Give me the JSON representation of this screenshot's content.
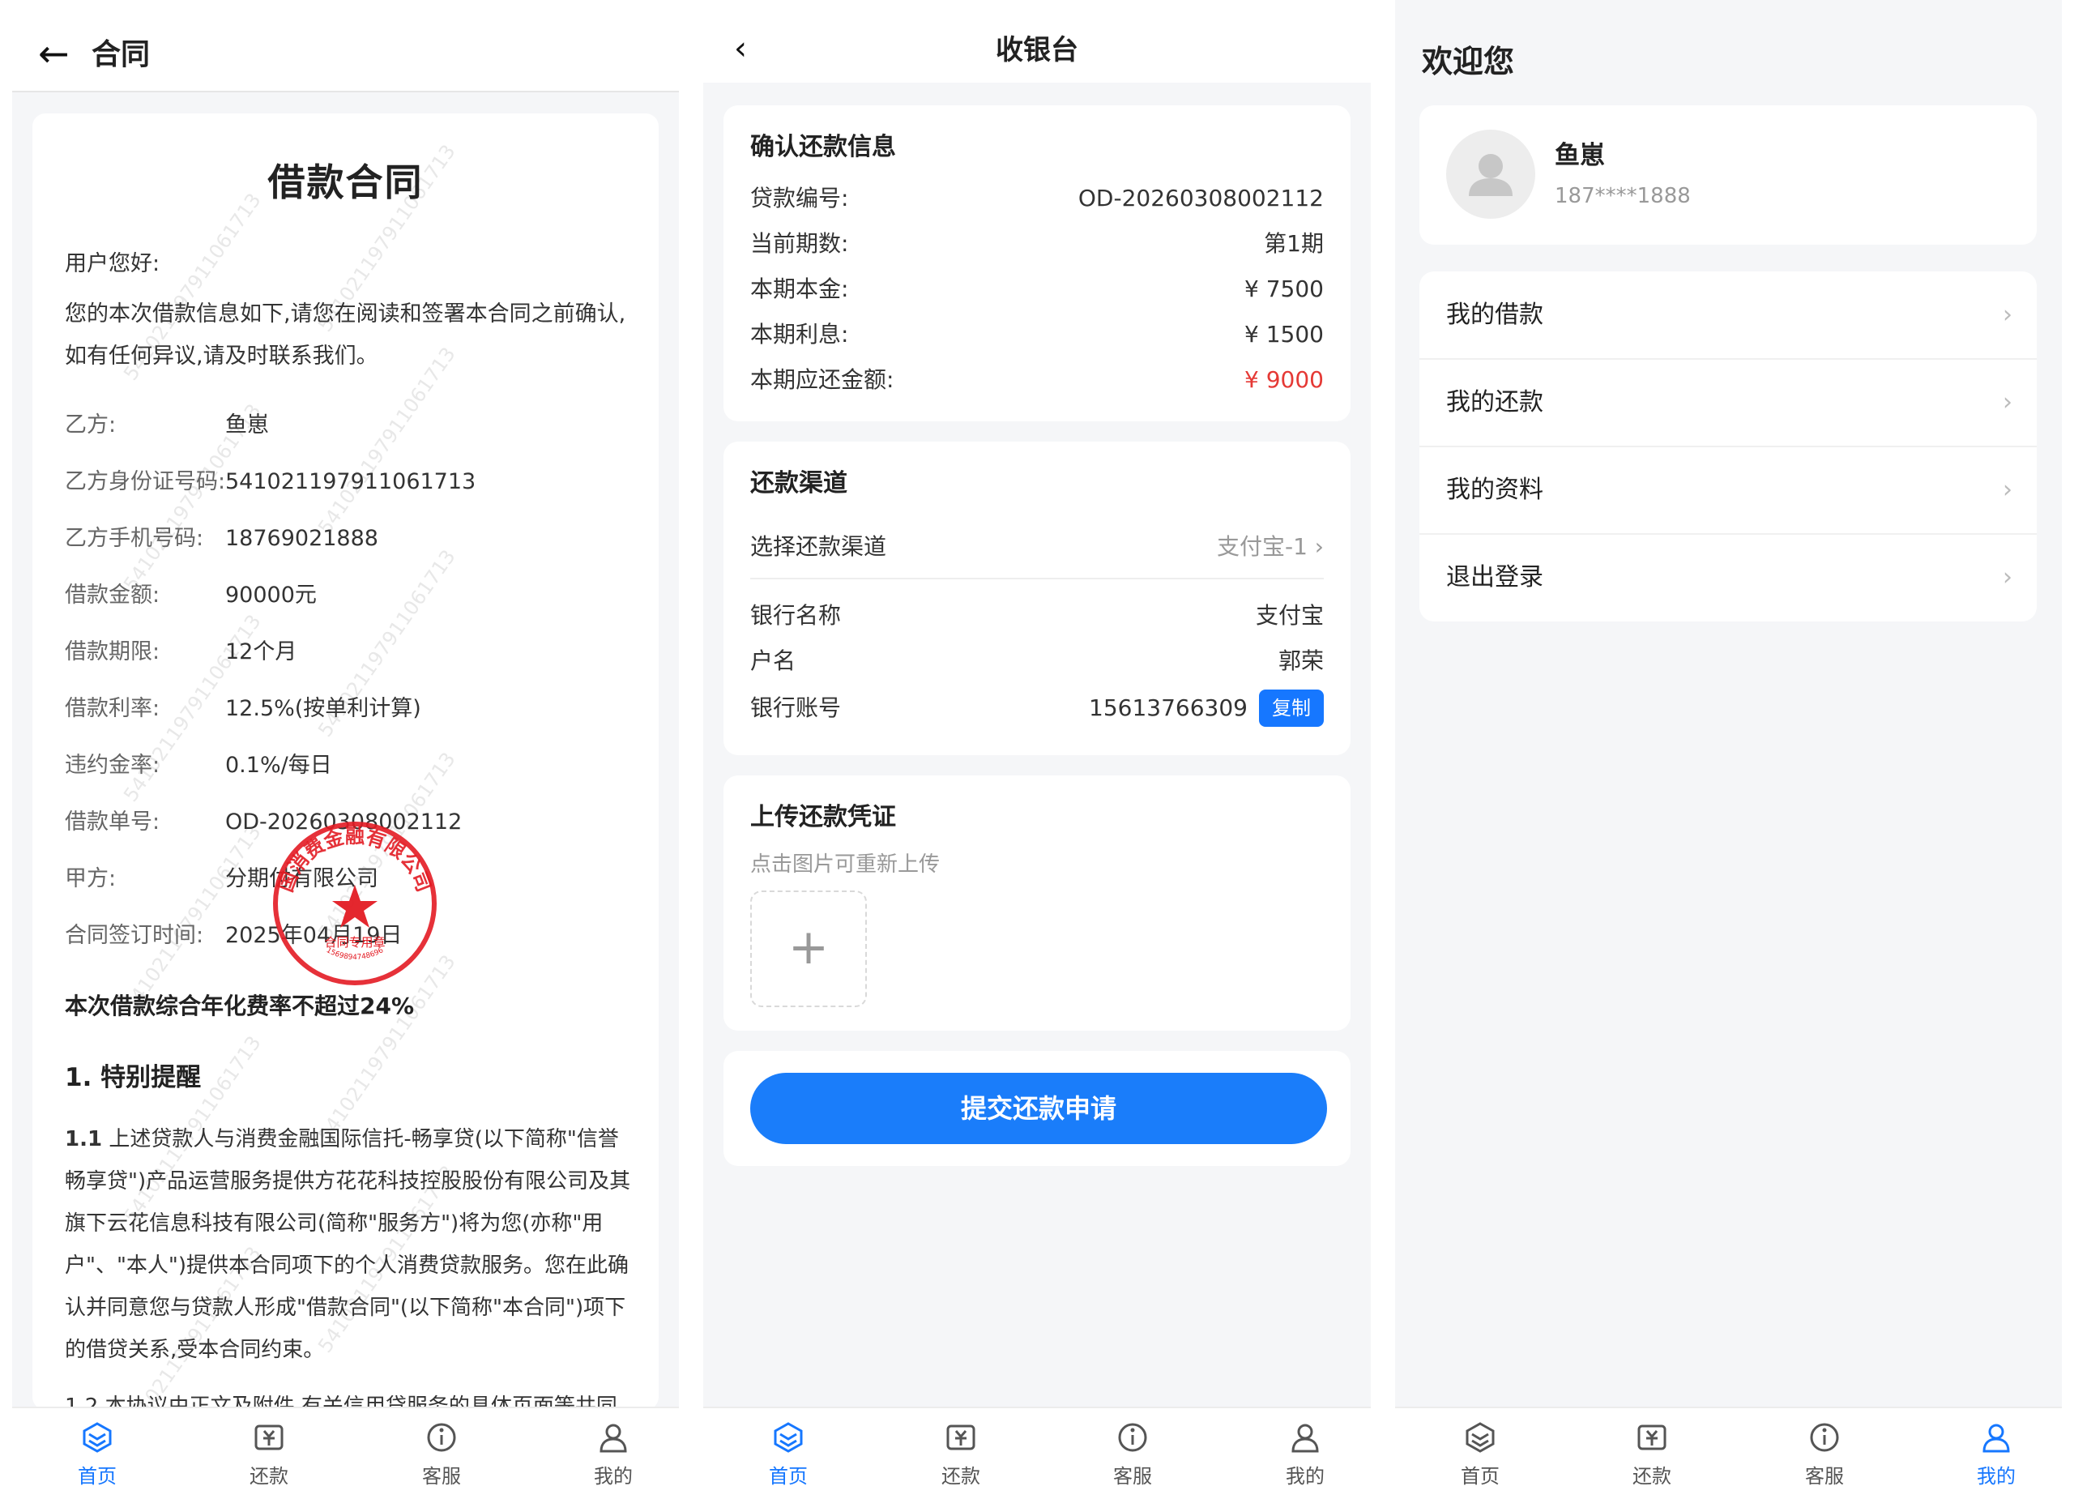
{
  "colors": {
    "accent": "#1677ff",
    "danger": "#e53935",
    "seal": "#e31b23",
    "background": "#f5f6f8"
  },
  "contract": {
    "back_icon": "arrow-left-icon",
    "header_title": "合同",
    "doc_title": "借款合同",
    "greeting": "用户您好:",
    "intro": "您的本次借款信息如下,请您在阅读和签署本合同之前确认,如有任何异议,请及时联系我们。",
    "rows": [
      {
        "label": "乙方:",
        "value": "鱼崽"
      },
      {
        "label": "乙方身份证号码:",
        "value": "541021197911061713"
      },
      {
        "label": "乙方手机号码:",
        "value": "18769021888"
      },
      {
        "label": "借款金额:",
        "value": "90000元"
      },
      {
        "label": "借款期限:",
        "value": "12个月"
      },
      {
        "label": "借款利率:",
        "value": "12.5%(按单利计算)"
      },
      {
        "label": "违约金率:",
        "value": "0.1%/每日"
      },
      {
        "label": "借款单号:",
        "value": "OD-20260308002112"
      },
      {
        "label": "甲方:",
        "value": "分期付有限公司"
      },
      {
        "label": "合同签订时间:",
        "value": "2025年04月19日"
      }
    ],
    "annual_rate_note": "本次借款综合年化费率不超过24%",
    "section_title": "1. 特别提醒",
    "clause_number": "1.1",
    "clause_text": "上述贷款人与消费金融国际信托-畅享贷(以下简称\"信誉畅享贷\")产品运营服务提供方花花科技控股股份有限公司及其旗下云花信息科技有限公司(简称\"服务方\")将为您(亦称\"用户\"、\"本人\")提供本合同项下的个人消费贷款服务。您在此确认并同意您与贷款人形成\"借款合同\"(以下简称\"本合同\")项下的借贷关系,受本合同约束。",
    "clause_cut": "1.2 本协议由正文及附件,有关信用贷服务的具体页面等共同",
    "watermark": "541021197911061713",
    "seal": {
      "top_text": "国消费金融有限公司",
      "bottom_text": "合同专用章",
      "code": "1569894748696"
    }
  },
  "cashier": {
    "back_icon": "chevron-left-icon",
    "title": "收银台",
    "confirm": {
      "title": "确认还款信息",
      "rows": [
        {
          "label": "贷款编号:",
          "value": "OD-20260308002112"
        },
        {
          "label": "当前期数:",
          "value": "第1期"
        },
        {
          "label": "本期本金:",
          "value": "¥ 7500"
        },
        {
          "label": "本期利息:",
          "value": "¥ 1500"
        },
        {
          "label": "本期应还金额:",
          "value": "¥ 9000"
        }
      ]
    },
    "channel": {
      "title": "还款渠道",
      "select_label": "选择还款渠道",
      "select_value": "支付宝-1 ›",
      "bank_name_label": "银行名称",
      "bank_name_value": "支付宝",
      "account_name_label": "户名",
      "account_name_value": "郭荣",
      "account_no_label": "银行账号",
      "account_no_value": "15613766309",
      "copy_label": "复制"
    },
    "upload": {
      "title": "上传还款凭证",
      "hint": "点击图片可重新上传",
      "plus": "+"
    },
    "submit_label": "提交还款申请"
  },
  "mine": {
    "welcome": "欢迎您",
    "user_name": "鱼崽",
    "phone": "187****1888",
    "avatar_icon": "user-avatar-icon",
    "menu": [
      {
        "label": "我的借款",
        "chevron": "›"
      },
      {
        "label": "我的还款",
        "chevron": "›"
      },
      {
        "label": "我的资料",
        "chevron": "›"
      },
      {
        "label": "退出登录",
        "chevron": "›"
      }
    ]
  },
  "tabbar": [
    {
      "label": "首页",
      "icon": "home-icon"
    },
    {
      "label": "还款",
      "icon": "repay-icon"
    },
    {
      "label": "客服",
      "icon": "service-icon"
    },
    {
      "label": "我的",
      "icon": "profile-icon"
    }
  ]
}
